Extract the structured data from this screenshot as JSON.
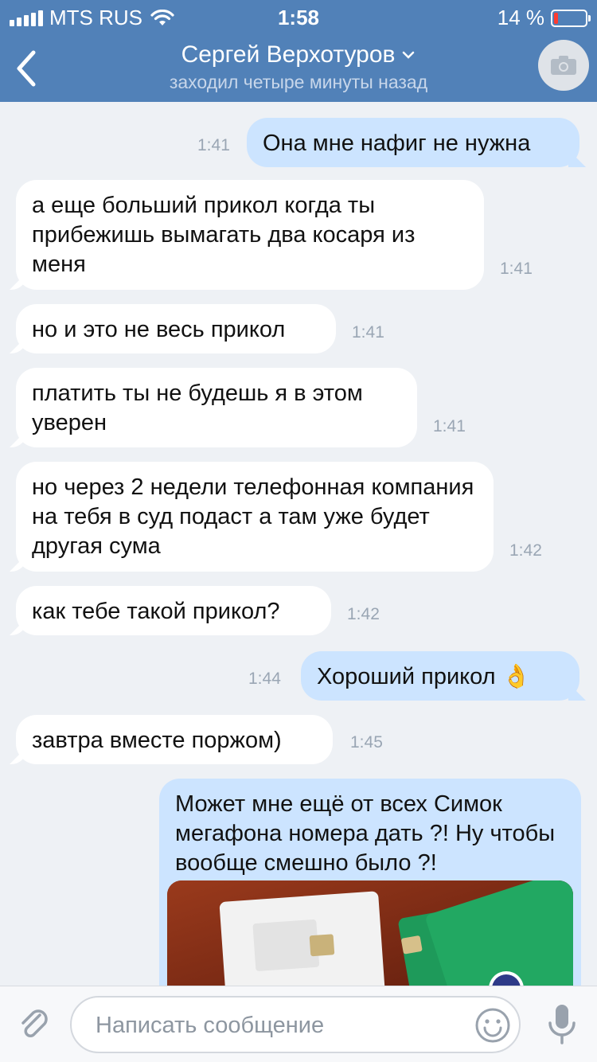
{
  "status_bar": {
    "carrier": "MTS RUS",
    "time": "1:58",
    "battery": "14 %",
    "battery_level": 0.14
  },
  "header": {
    "title": "Сергей Верхотуров",
    "subtitle": "заходил четыре минуты назад",
    "back_icon": "chevron-left-icon",
    "title_chevron_icon": "chevron-down-icon",
    "camera_icon": "camera-icon"
  },
  "messages": [
    {
      "direction": "out",
      "text": "Она мне нафиг не нужна",
      "time": "1:41"
    },
    {
      "direction": "in",
      "text": "а еще больший прикол когда ты прибежишь вымагать два косаря из меня",
      "time": "1:41"
    },
    {
      "direction": "in",
      "text": "но и это не весь прикол",
      "time": "1:41"
    },
    {
      "direction": "in",
      "text": "платить ты не будешь я в этом уверен",
      "time": "1:41"
    },
    {
      "direction": "in",
      "text": "но через 2 недели телефонная компания на тебя в суд подаст а там уже будет другая сума",
      "time": "1:42"
    },
    {
      "direction": "in",
      "text": "как тебе такой прикол?",
      "time": "1:42"
    },
    {
      "direction": "out",
      "text": "Хороший прикол 👌",
      "time": "1:44"
    },
    {
      "direction": "in",
      "text": "завтра вместе поржом)",
      "time": "1:45"
    },
    {
      "direction": "out",
      "text": "Может мне ещё от всех Симок мегафона номера дать ?! Ну чтобы вообще смешно было ?!",
      "time": "",
      "has_photo": true
    }
  ],
  "composer": {
    "placeholder": "Написать сообщение",
    "attach_icon": "paperclip-icon",
    "emoji_icon": "smiley-icon",
    "mic_icon": "microphone-icon"
  },
  "colors": {
    "header": "#5181b8",
    "background": "#eef1f5",
    "incoming_bubble": "#ffffff",
    "outgoing_bubble": "#cce4ff"
  }
}
